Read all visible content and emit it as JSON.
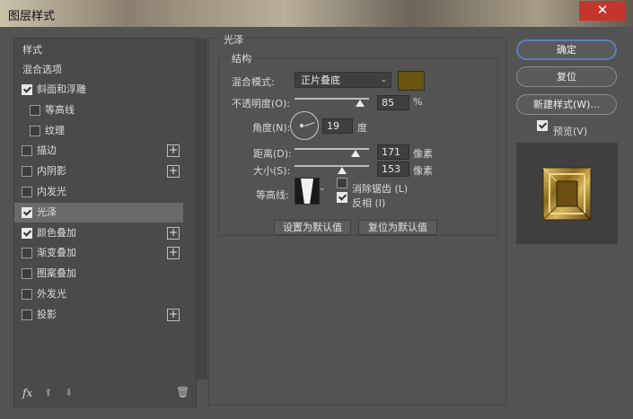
{
  "window": {
    "title": "图层样式",
    "close_glyph": "✕"
  },
  "sidebar": {
    "header": "样式",
    "blend_options": "混合选项",
    "items": [
      {
        "label": "斜面和浮雕",
        "checked": true
      },
      {
        "label": "等高线",
        "checked": false
      },
      {
        "label": "纹理",
        "checked": false
      },
      {
        "label": "描边",
        "checked": false,
        "plus": "+"
      },
      {
        "label": "内阴影",
        "checked": false,
        "plus": "+"
      },
      {
        "label": "内发光",
        "checked": false
      },
      {
        "label": "光泽",
        "checked": true,
        "selected": true
      },
      {
        "label": "颜色叠加",
        "checked": true,
        "plus": "+"
      },
      {
        "label": "渐变叠加",
        "checked": false,
        "plus": "+"
      },
      {
        "label": "图案叠加",
        "checked": false
      },
      {
        "label": "外发光",
        "checked": false
      },
      {
        "label": "投影",
        "checked": false,
        "plus": "+"
      }
    ],
    "fx_label": "fx",
    "up_glyph": "⬆",
    "down_glyph": "⬇",
    "trash_glyph": "🗑"
  },
  "satin": {
    "group_title": "光泽",
    "structure_title": "结构",
    "blend_mode_label": "混合模式:",
    "blend_mode_value": "正片叠底",
    "chevron": "⌄",
    "color": "#6a5510",
    "opacity_label": "不透明度(O):",
    "opacity_value": "85",
    "opacity_unit": "%",
    "angle_label": "角度(N):",
    "angle_value": "19",
    "angle_unit": "度",
    "distance_label": "距离(D):",
    "distance_value": "171",
    "distance_unit": "像素",
    "size_label": "大小(S):",
    "size_value": "153",
    "size_unit": "像素",
    "contour_label": "等高线:",
    "antialias_label": "消除锯齿 (L)",
    "antialias_checked": false,
    "invert_label": "反相 (I)",
    "invert_checked": true,
    "make_default": "设置为默认值",
    "reset_default": "复位为默认值"
  },
  "actions": {
    "ok": "确定",
    "reset": "复位",
    "new_style": "新建样式(W)...",
    "preview_label": "预览(V)",
    "preview_checked": true
  }
}
